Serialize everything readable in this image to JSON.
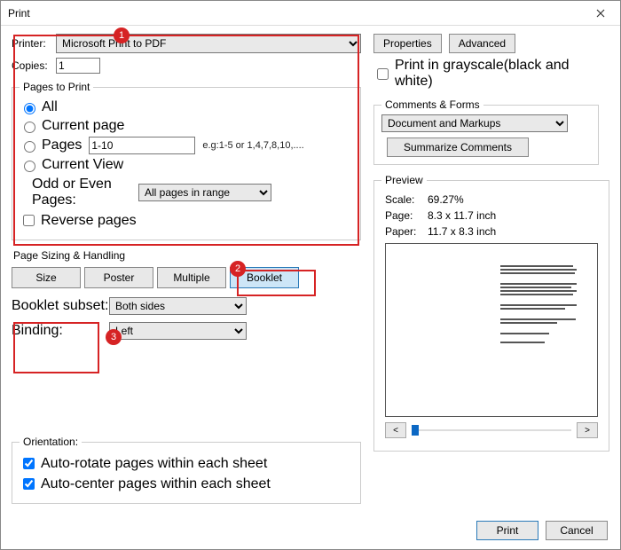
{
  "title": "Print",
  "printer": {
    "label": "Printer:",
    "value": "Microsoft Print to PDF"
  },
  "copies": {
    "label": "Copies:",
    "value": "1"
  },
  "buttons": {
    "properties": "Properties",
    "advanced": "Advanced",
    "summarize": "Summarize Comments",
    "print": "Print",
    "cancel": "Cancel"
  },
  "grayscale": {
    "label": "Print in grayscale(black and white)"
  },
  "pagesToPrint": {
    "legend": "Pages to Print",
    "all": "All",
    "current": "Current page",
    "pages": "Pages",
    "pagesValue": "1-10",
    "pagesHint": "e.g:1-5 or 1,4,7,8,10,....",
    "currentView": "Current View",
    "oddEvenLabel": "Odd or Even Pages:",
    "oddEvenValue": "All pages in range",
    "reverse": "Reverse pages"
  },
  "sizing": {
    "title": "Page Sizing & Handling",
    "size": "Size",
    "poster": "Poster",
    "multiple": "Multiple",
    "booklet": "Booklet",
    "subsetLabel": "Booklet subset:",
    "subsetValue": "Both sides",
    "bindingLabel": "Binding:",
    "bindingValue": "Left"
  },
  "orientation": {
    "legend": "Orientation:",
    "autoRotate": "Auto-rotate pages within each sheet",
    "autoCenter": "Auto-center pages within each sheet"
  },
  "comments": {
    "legend": "Comments & Forms",
    "value": "Document and Markups"
  },
  "preview": {
    "legend": "Preview",
    "scaleLabel": "Scale:",
    "scaleValue": "69.27%",
    "pageLabel": "Page:",
    "pageValue": "8.3 x 11.7 inch",
    "paperLabel": "Paper:",
    "paperValue": "11.7 x 8.3 inch",
    "prev": "<",
    "next": ">"
  },
  "annotations": {
    "n1": "1",
    "n2": "2",
    "n3": "3"
  }
}
